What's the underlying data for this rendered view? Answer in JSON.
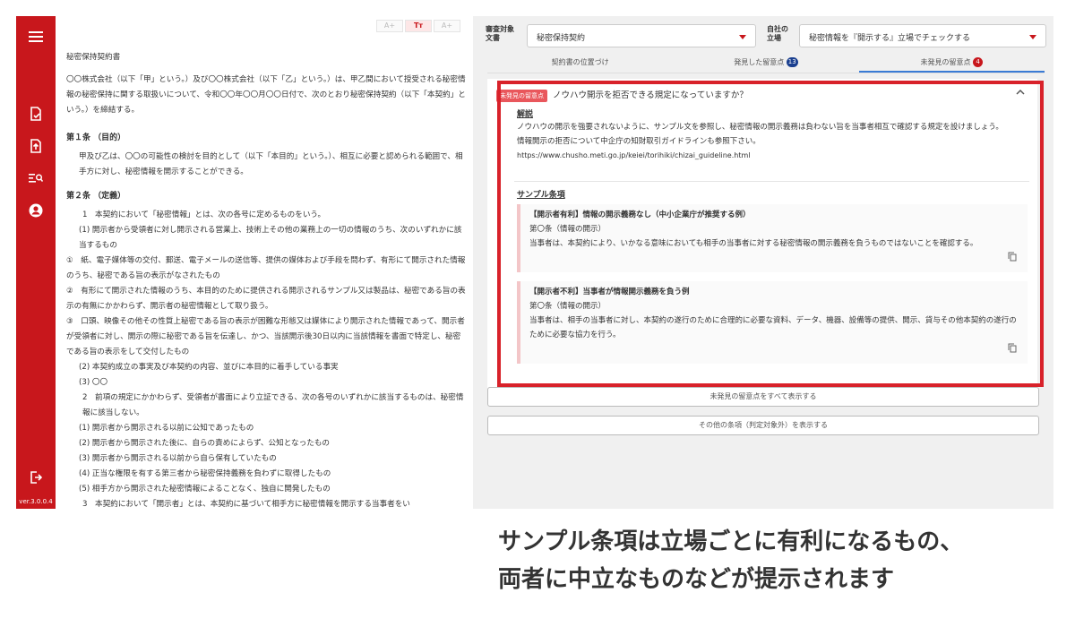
{
  "sidebar": {
    "icons": [
      "menu-icon",
      "document-check-icon",
      "document-upload-icon",
      "search-list-icon",
      "user-icon",
      "logout-icon"
    ],
    "version": "ver.3.0.0.4",
    "color": "#c8171c"
  },
  "font_controls": {
    "decrease": "A+",
    "reset": "Tт",
    "increase": "A+"
  },
  "document": {
    "title": "秘密保持契約書",
    "intro": "〇〇株式会社（以下「甲」という。）及び〇〇株式会社（以下「乙」という。）は、甲乙間において授受される秘密情報の秘密保持に関する取扱いについて、令和〇〇年〇〇月〇〇日付で、次のとおり秘密保持契約（以下「本契約」という。）を締結する。",
    "art1_title": "第１条 （目的）",
    "art1_body": "甲及び乙は、〇〇の可能性の検討を目的として（以下「本目的」という。）、相互に必要と認められる範囲で、相手方に対し、秘密情報を開示することができる。",
    "art2_title": "第２条 （定義）",
    "lines": [
      "1　本契約において「秘密情報」とは、次の各号に定めるものをいう。",
      "(1) 開示者から受領者に対し開示される営業上、技術上その他の業務上の一切の情報のうち、次のいずれかに該当するもの",
      "①　紙、電子媒体等の交付、郵送、電子メールの送信等、提供の媒体および手段を問わず、有形にて開示された情報のうち、秘密である旨の表示がなされたもの",
      "②　有形にて開示された情報のうち、本目的のために提供される開示されるサンプル又は製品は、秘密である旨の表示の有無にかかわらず、開示者の秘密情報として取り扱う。",
      "③　口頭、映像その他その性質上秘密である旨の表示が困難な形態又は媒体により開示された情報であって、開示者が受領者に対し、開示の際に秘密である旨を伝達し、かつ、当該開示後30日以内に当該情報を書面で特定し、秘密である旨の表示をして交付したもの",
      "(2) 本契約成立の事実及び本契約の内容、並びに本目的に着手している事実",
      "(3) 〇〇",
      "2　前項の規定にかかわらず、受領者が書面により立証できる、次の各号のいずれかに該当するものは、秘密情報に該当しない。",
      "(1) 開示者から開示される以前に公知であったもの",
      "(2) 開示者から開示された後に、自らの責めによらず、公知となったもの",
      "(3) 開示者から開示される以前から自ら保有していたもの",
      "(4) 正当な権限を有する第三者から秘密保持義務を負わずに取得したもの",
      "(5) 相手方から開示された秘密情報によることなく、独自に開発したもの",
      "3　本契約において「開示者」とは、本契約に基づいて相手方に秘密情報を開示する当事者をい"
    ]
  },
  "review": {
    "doc_type_label": "審査対象文書",
    "doc_type_value": "秘密保持契約",
    "position_label": "自社の立場",
    "position_value": "秘密情報を『開示する』立場でチェックする",
    "tabs": [
      {
        "label": "契約書の位置づけ",
        "badge": ""
      },
      {
        "label": "発見した留意点",
        "badge": "13"
      },
      {
        "label": "未発見の留意点",
        "badge": "4"
      }
    ],
    "badge_colors": {
      "found": "#1a3f8f",
      "missing": "#c8171c"
    },
    "card": {
      "tag": "未発見の留意点",
      "question": "ノウハウ開示を拒否できる規定になっていますか？",
      "expl_heading": "解説",
      "expl_text": "ノウハウの開示を強要されないように、サンプル文を参照し、秘密情報の開示義務は負わない旨を当事者相互で確認する規定を設けましょう。",
      "expl_text2": "情報開示の拒否について中企庁の知財取引ガイドラインも参照下さい。",
      "expl_url": "https://www.chusho.meti.go.jp/keiei/torihiki/chizai_guideline.html",
      "sample_heading": "サンプル条項",
      "clauses": [
        {
          "title": "【開示者有利】情報の開示義務なし（中小企業庁が推奨する例）",
          "article": "第〇条（情報の開示）",
          "body": "当事者は、本契約により、いかなる意味においても相手の当事者に対する秘密情報の開示義務を負うものではないことを確認する。"
        },
        {
          "title": "【開示者不利】当事者が情報開示義務を負う例",
          "article": "第〇条（情報の開示）",
          "body": "当事者は、相手の当事者に対し、本契約の遂行のために合理的に必要な資料、データ、機器、設備等の提供、開示、貸与その他本契約の遂行のために必要な協力を行う。"
        }
      ]
    },
    "show_all_missing": "未発見の留意点をすべて表示する",
    "show_other": "その他の条項（判定対象外）を表示する"
  },
  "caption": {
    "line1": "サンプル条項は立場ごとに有利になるもの、",
    "line2": "両者に中立なものなどが提示されます"
  }
}
